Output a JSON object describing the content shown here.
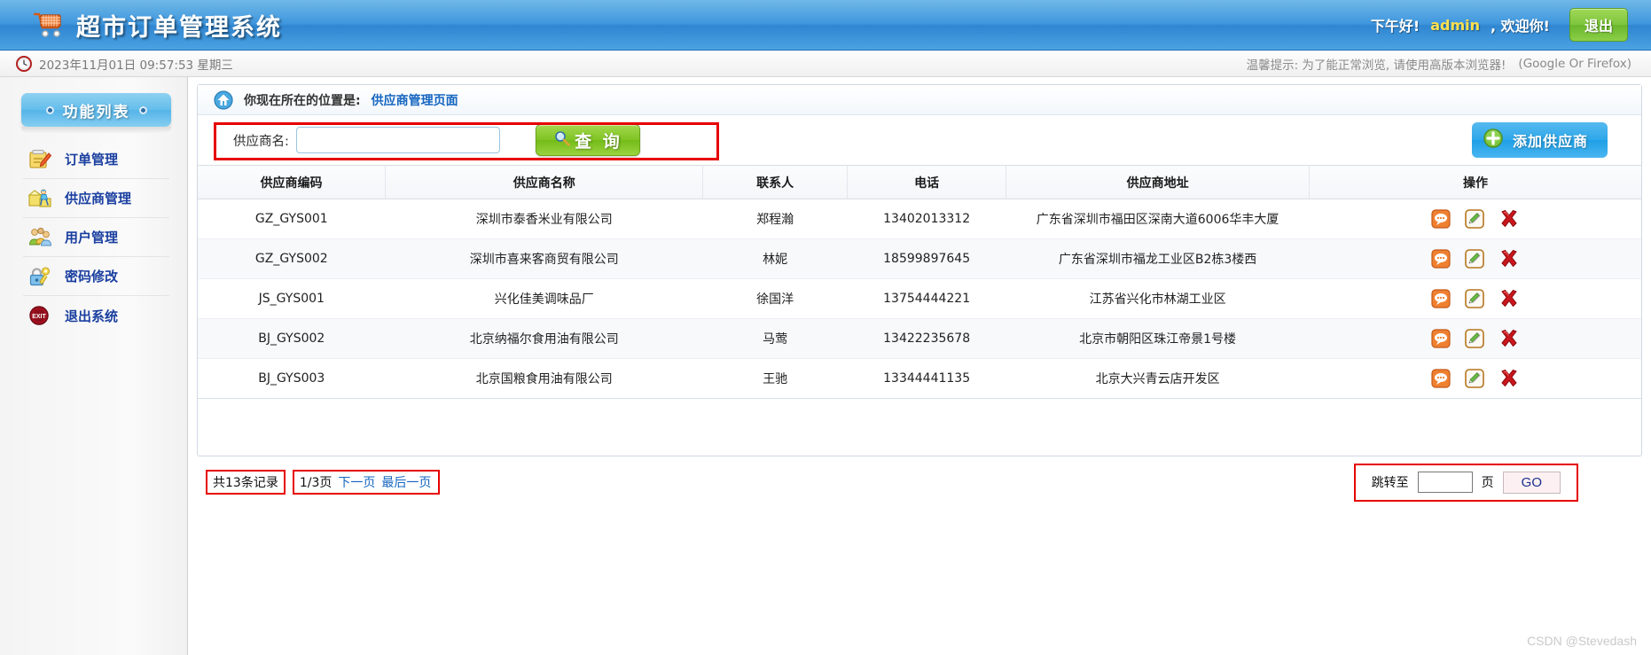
{
  "header": {
    "logo_icon": "shopping-cart-icon",
    "title": "超市订单管理系统",
    "greeting": "下午好!",
    "username": "admin",
    "welcome": ", 欢迎你!",
    "logout_label": "退出",
    "brand_color": "#3f96dd",
    "username_color": "#ffe14d",
    "logout_color": "#7ec63c"
  },
  "infobar": {
    "clock_icon": "clock-icon",
    "datetime": "2023年11月01日 09:57:53 星期三",
    "tip": "温馨提示: 为了能正常浏览, 请使用高版本浏览器!",
    "browsers": "(Google Or Firefox)"
  },
  "sidebar": {
    "heading": "功能列表",
    "items": [
      {
        "label": "订单管理",
        "icon": "order-list-icon"
      },
      {
        "label": "供应商管理",
        "icon": "supplier-delivery-icon"
      },
      {
        "label": "用户管理",
        "icon": "users-icon"
      },
      {
        "label": "密码修改",
        "icon": "lock-key-icon"
      },
      {
        "label": "退出系统",
        "icon": "exit-icon"
      }
    ]
  },
  "breadcrumb": {
    "home_icon": "home-icon",
    "prefix": "你现在所在的位置是:",
    "current": "供应商管理页面"
  },
  "search": {
    "label": "供应商名:",
    "value": "",
    "placeholder": "",
    "query_label": "查 询",
    "query_icon": "magnifier-icon",
    "add_label": "添加供应商",
    "add_icon": "plus-circle-icon"
  },
  "table": {
    "columns": [
      "供应商编码",
      "供应商名称",
      "联系人",
      "电话",
      "供应商地址",
      "操作"
    ],
    "rows": [
      {
        "code": "GZ_GYS001",
        "name": "深圳市泰香米业有限公司",
        "contact": "郑程瀚",
        "phone": "13402013312",
        "address": "广东省深圳市福田区深南大道6006华丰大厦"
      },
      {
        "code": "GZ_GYS002",
        "name": "深圳市喜来客商贸有限公司",
        "contact": "林妮",
        "phone": "18599897645",
        "address": "广东省深圳市福龙工业区B2栋3楼西"
      },
      {
        "code": "JS_GYS001",
        "name": "兴化佳美调味品厂",
        "contact": "徐国洋",
        "phone": "13754444221",
        "address": "江苏省兴化市林湖工业区"
      },
      {
        "code": "BJ_GYS002",
        "name": "北京纳福尔食用油有限公司",
        "contact": "马莺",
        "phone": "13422235678",
        "address": "北京市朝阳区珠江帝景1号楼"
      },
      {
        "code": "BJ_GYS003",
        "name": "北京国粮食用油有限公司",
        "contact": "王驰",
        "phone": "13344441135",
        "address": "北京大兴青云店开发区"
      }
    ],
    "row_actions": [
      {
        "icon": "view-detail-icon",
        "color": "#e8721f"
      },
      {
        "icon": "edit-pencil-icon",
        "color": "#b5751f"
      },
      {
        "icon": "delete-cross-icon",
        "color": "#c10a0a"
      }
    ]
  },
  "pagination": {
    "total": "共13条记录",
    "page_indicator": "1/3页",
    "next_label": "下一页",
    "last_label": "最后一页",
    "jump_label": "跳转至",
    "jump_value": "",
    "page_unit": "页",
    "go_label": "GO"
  },
  "watermark": "CSDN @Stevedash"
}
